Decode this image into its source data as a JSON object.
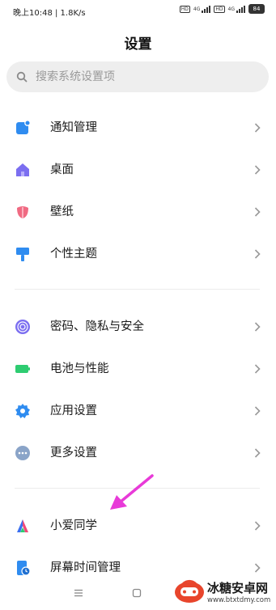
{
  "status_bar": {
    "time_speed": "晚上10:48 | 1.8K/s",
    "hd_label": "HD",
    "network_label": "4G",
    "battery": "84"
  },
  "header": {
    "title": "设置"
  },
  "search": {
    "placeholder": "搜索系统设置项"
  },
  "section1": [
    {
      "label": "通知管理",
      "icon": "notification-icon",
      "color": "#2f8cf0"
    },
    {
      "label": "桌面",
      "icon": "home-icon",
      "color": "#7b6ef0"
    },
    {
      "label": "壁纸",
      "icon": "tulip-icon",
      "color": "#f06a82"
    },
    {
      "label": "个性主题",
      "icon": "paint-brush-icon",
      "color": "#2f8cf0"
    }
  ],
  "section2": [
    {
      "label": "密码、隐私与安全",
      "icon": "fingerprint-icon",
      "color": "#7b6ef0"
    },
    {
      "label": "电池与性能",
      "icon": "battery-icon",
      "color": "#2ecc71"
    },
    {
      "label": "应用设置",
      "icon": "gear-icon",
      "color": "#2f8cf0"
    },
    {
      "label": "更多设置",
      "icon": "more-icon",
      "color": "#8aa4c8"
    }
  ],
  "section3": [
    {
      "label": "小爱同学",
      "icon": "xiaoai-icon"
    },
    {
      "label": "屏幕时间管理",
      "icon": "screen-time-icon",
      "color": "#2f8cf0"
    }
  ],
  "annotation": {
    "arrow_color": "#e83ad8"
  },
  "watermark": {
    "site_name": "冰糖安卓网",
    "url": "www.btxtdmy.com"
  }
}
